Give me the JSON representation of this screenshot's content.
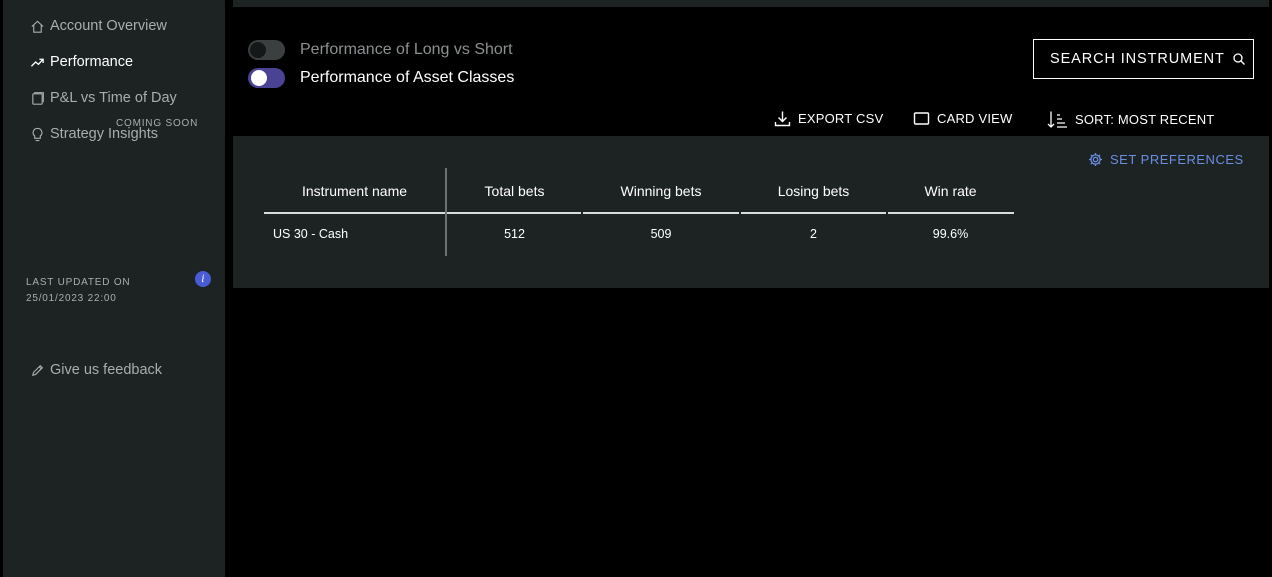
{
  "sidebar": {
    "items": [
      {
        "label": "Account Overview",
        "icon": "home-icon"
      },
      {
        "label": "Performance",
        "icon": "trend-up-icon"
      },
      {
        "label": "P&L vs Time of Day",
        "icon": "clock-doc-icon"
      },
      {
        "label": "Strategy Insights",
        "icon": "lightbulb-icon"
      }
    ],
    "coming_soon": "COMING SOON",
    "last_updated_label": "LAST UPDATED ON",
    "last_updated_value": "25/01/2023 22:00",
    "info_badge": "i",
    "feedback_label": "Give us feedback"
  },
  "toggles": {
    "long_vs_short": {
      "label": "Performance of Long vs Short",
      "state": "off"
    },
    "asset_classes": {
      "label": "Performance of Asset Classes",
      "state": "on"
    }
  },
  "search": {
    "label": "SEARCH INSTRUMENT"
  },
  "actions": {
    "export": "EXPORT CSV",
    "card_view": "CARD VIEW",
    "sort": "SORT: MOST RECENT"
  },
  "panel": {
    "set_preferences": "SET PREFERENCES"
  },
  "table": {
    "columns": [
      "Instrument name",
      "Total bets",
      "Winning bets",
      "Losing bets",
      "Win rate"
    ],
    "rows": [
      [
        "US 30 - Cash",
        "512",
        "509",
        "2",
        "99.6%"
      ]
    ]
  },
  "colors": {
    "sidebar_bg": "#1d2223",
    "accent_blue": "#6a8fe0",
    "toggle_on": "#4a4394",
    "badge": "#4a5bd6"
  }
}
